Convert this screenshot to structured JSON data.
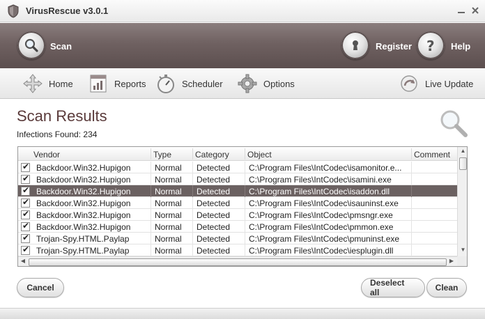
{
  "window": {
    "title": "VirusRescue v3.0.1"
  },
  "header": {
    "scan_label": "Scan",
    "register_label": "Register",
    "help_label": "Help"
  },
  "toolbar": {
    "home_label": "Home",
    "reports_label": "Reports",
    "scheduler_label": "Scheduler",
    "options_label": "Options",
    "live_update_label": "Live Update"
  },
  "results": {
    "title": "Scan Results",
    "infections_text": "Infections Found: 234",
    "columns": [
      "Vendor",
      "Type",
      "Category",
      "Object",
      "Comment"
    ],
    "rows": [
      {
        "vendor": "Backdoor.Win32.Hupigon",
        "type": "Normal",
        "category": "Detected",
        "object": "C:\\Program Files\\IntCodec\\isamonitor.e...",
        "comment": "",
        "checked": true,
        "selected": false
      },
      {
        "vendor": "Backdoor.Win32.Hupigon",
        "type": "Normal",
        "category": "Detected",
        "object": "C:\\Program Files\\IntCodec\\isamini.exe",
        "comment": "",
        "checked": true,
        "selected": false
      },
      {
        "vendor": "Backdoor.Win32.Hupigon",
        "type": "Normal",
        "category": "Detected",
        "object": "C:\\Program Files\\IntCodec\\isaddon.dll",
        "comment": "",
        "checked": true,
        "selected": true
      },
      {
        "vendor": "Backdoor.Win32.Hupigon",
        "type": "Normal",
        "category": "Detected",
        "object": "C:\\Program Files\\IntCodec\\isauninst.exe",
        "comment": "",
        "checked": true,
        "selected": false
      },
      {
        "vendor": "Backdoor.Win32.Hupigon",
        "type": "Normal",
        "category": "Detected",
        "object": "C:\\Program Files\\IntCodec\\pmsngr.exe",
        "comment": "",
        "checked": true,
        "selected": false
      },
      {
        "vendor": "Backdoor.Win32.Hupigon",
        "type": "Normal",
        "category": "Detected",
        "object": "C:\\Program Files\\IntCodec\\pmmon.exe",
        "comment": "",
        "checked": true,
        "selected": false
      },
      {
        "vendor": "Trojan-Spy.HTML.Paylap",
        "type": "Normal",
        "category": "Detected",
        "object": "C:\\Program Files\\IntCodec\\pmuninst.exe",
        "comment": "",
        "checked": true,
        "selected": false
      },
      {
        "vendor": "Trojan-Spy.HTML.Paylap",
        "type": "Normal",
        "category": "Detected",
        "object": "C:\\Program Files\\IntCodec\\iesplugin.dll",
        "comment": "",
        "checked": true,
        "selected": false
      }
    ]
  },
  "buttons": {
    "cancel_label": "Cancel",
    "deselect_all_label": "Deselect all",
    "clean_label": "Clean"
  },
  "colors": {
    "header_band": "#6f6161",
    "title_text": "#5a3a3a",
    "selected_row": "#6b6161"
  },
  "icons": {
    "app": "shield-icon",
    "scan": "magnifier-icon",
    "register": "keyhole-icon",
    "help": "question-icon",
    "home": "arrows-icon",
    "reports": "report-icon",
    "scheduler": "stopwatch-icon",
    "options": "gear-icon",
    "live_update": "update-icon"
  }
}
